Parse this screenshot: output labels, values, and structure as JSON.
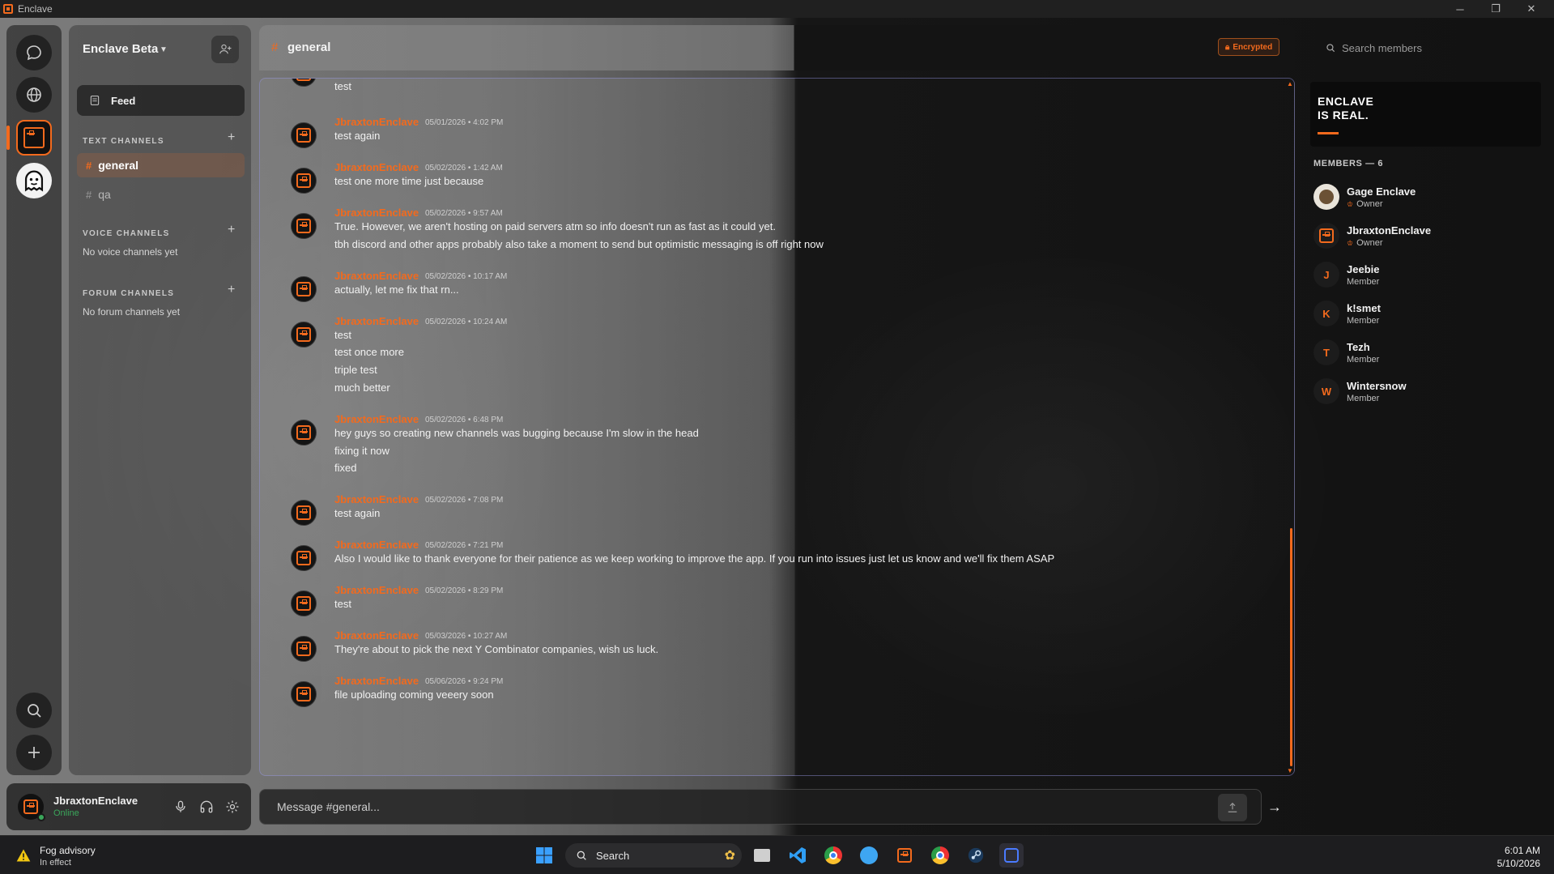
{
  "window": {
    "title": "Enclave"
  },
  "server": {
    "name": "Enclave Beta"
  },
  "nav": {
    "feed_label": "Feed"
  },
  "sections": {
    "text_title": "TEXT CHANNELS",
    "voice_title": "VOICE CHANNELS",
    "voice_empty": "No voice channels yet",
    "forum_title": "FORUM CHANNELS",
    "forum_empty": "No forum channels yet"
  },
  "channels": [
    {
      "name": "general",
      "active": true
    },
    {
      "name": "qa",
      "active": false
    }
  ],
  "header": {
    "channel": "general",
    "badge": "Encrypted"
  },
  "messages": [
    {
      "author": "",
      "time": "",
      "lines": [
        "test"
      ]
    },
    {
      "author": "JbraxtonEnclave",
      "time": "05/01/2026 • 4:02 PM",
      "lines": [
        "test again"
      ]
    },
    {
      "author": "JbraxtonEnclave",
      "time": "05/02/2026 • 1:42 AM",
      "lines": [
        "test one more time just because"
      ]
    },
    {
      "author": "JbraxtonEnclave",
      "time": "05/02/2026 • 9:57 AM",
      "lines": [
        "True. However, we aren't hosting on paid servers atm so info doesn't run as fast as it could yet.",
        "tbh discord and other apps probably also take a moment to send but optimistic messaging is off right now"
      ]
    },
    {
      "author": "JbraxtonEnclave",
      "time": "05/02/2026 • 10:17 AM",
      "lines": [
        "actually, let me fix that rn..."
      ]
    },
    {
      "author": "JbraxtonEnclave",
      "time": "05/02/2026 • 10:24 AM",
      "lines": [
        "test",
        "test once more",
        "triple test",
        "much better"
      ]
    },
    {
      "author": "JbraxtonEnclave",
      "time": "05/02/2026 • 6:48 PM",
      "lines": [
        "hey guys so creating new channels was bugging because I'm slow in the head",
        "fixing it now",
        "fixed"
      ]
    },
    {
      "author": "JbraxtonEnclave",
      "time": "05/02/2026 • 7:08 PM",
      "lines": [
        "test again"
      ]
    },
    {
      "author": "JbraxtonEnclave",
      "time": "05/02/2026 • 7:21 PM",
      "lines": [
        "Also I would like to thank everyone for their patience as we keep working to improve the app. If you run into issues just let us know and we'll fix them ASAP"
      ]
    },
    {
      "author": "JbraxtonEnclave",
      "time": "05/02/2026 • 8:29 PM",
      "lines": [
        "test"
      ]
    },
    {
      "author": "JbraxtonEnclave",
      "time": "05/03/2026 • 10:27 AM",
      "lines": [
        "They're about to pick the next Y Combinator companies, wish us luck."
      ]
    },
    {
      "author": "JbraxtonEnclave",
      "time": "05/06/2026 • 9:24 PM",
      "lines": [
        "file uploading coming veeery soon"
      ]
    }
  ],
  "composer": {
    "placeholder": "Message #general...",
    "send_symbol": "→"
  },
  "members": {
    "search_placeholder": "Search members",
    "banner_text": "ENCLAVE\nIS REAL.",
    "header": "MEMBERS — 6",
    "list": [
      {
        "name": "Gage Enclave",
        "role": "Owner",
        "initial": "",
        "owner": true
      },
      {
        "name": "JbraxtonEnclave",
        "role": "Owner",
        "initial": "",
        "owner": true
      },
      {
        "name": "Jeebie",
        "role": "Member",
        "initial": "J",
        "owner": false
      },
      {
        "name": "k!smet",
        "role": "Member",
        "initial": "K",
        "owner": false
      },
      {
        "name": "Tezh",
        "role": "Member",
        "initial": "T",
        "owner": false
      },
      {
        "name": "Wintersnow",
        "role": "Member",
        "initial": "W",
        "owner": false
      }
    ]
  },
  "user": {
    "name": "JbraxtonEnclave",
    "status": "Online"
  },
  "taskbar": {
    "weather_title": "Fog advisory",
    "weather_sub": "In effect",
    "search_label": "Search",
    "time": "6:01 AM",
    "date": "5/10/2026"
  },
  "colors": {
    "accent": "#f36a1d",
    "online": "#3aa65a"
  }
}
